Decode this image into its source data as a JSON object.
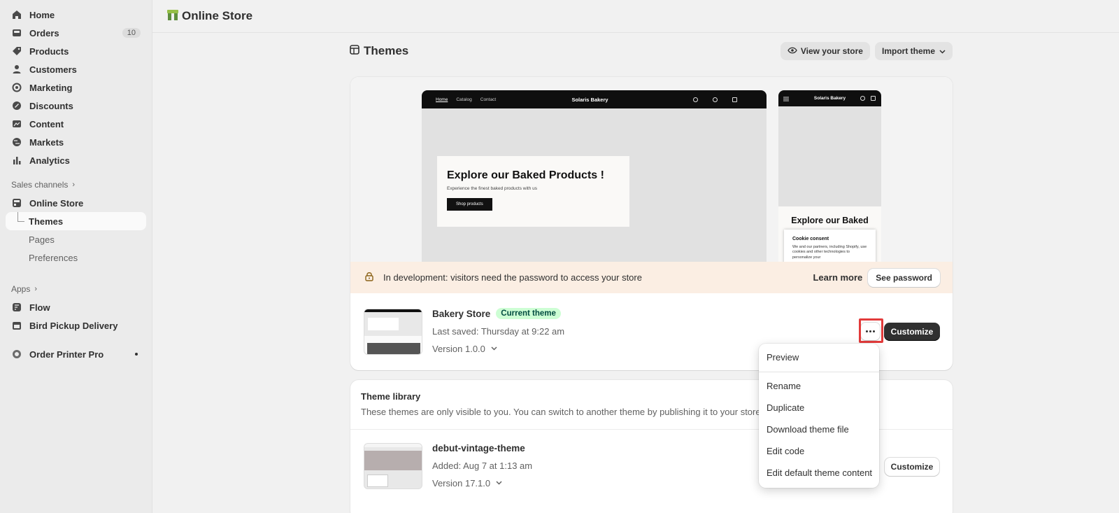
{
  "sidebar": {
    "nav": [
      {
        "label": "Home",
        "icon": "home-icon"
      },
      {
        "label": "Orders",
        "icon": "orders-icon",
        "badge": "10"
      },
      {
        "label": "Products",
        "icon": "tag-icon"
      },
      {
        "label": "Customers",
        "icon": "person-icon"
      },
      {
        "label": "Marketing",
        "icon": "target-icon"
      },
      {
        "label": "Discounts",
        "icon": "discount-icon"
      },
      {
        "label": "Content",
        "icon": "content-icon"
      },
      {
        "label": "Markets",
        "icon": "globe-icon"
      },
      {
        "label": "Analytics",
        "icon": "bar-chart-icon"
      }
    ],
    "sales_channels_label": "Sales channels",
    "online_store": "Online Store",
    "sub": [
      "Themes",
      "Pages",
      "Preferences"
    ],
    "apps_label": "Apps",
    "apps": [
      "Flow",
      "Bird Pickup Delivery"
    ],
    "order_printer": "Order Printer Pro"
  },
  "topbar": {
    "title": "Online Store"
  },
  "page": {
    "title": "Themes",
    "view_store": "View your store",
    "import_theme": "Import theme"
  },
  "preview": {
    "desktop": {
      "nav": [
        "Home",
        "Catalog",
        "Contact"
      ],
      "brand": "Solaris Bakery",
      "hero_title": "Explore our Baked Products !",
      "hero_sub": "Experience the finest baked products with us",
      "hero_button": "Shop products"
    },
    "mobile": {
      "brand": "Solaris Bakery",
      "hero_title": "Explore our Baked",
      "cookie_title": "Cookie consent",
      "cookie_text": "We and our partners, including Shopify, use cookies and other technologies to personalize your"
    }
  },
  "banner": {
    "message": "In development: visitors need the password to access your store",
    "learn_more": "Learn more",
    "see_password": "See password"
  },
  "current_theme": {
    "name": "Bakery Store",
    "tag": "Current theme",
    "saved": "Last saved: Thursday at 9:22 am",
    "version": "Version 1.0.0",
    "customize": "Customize"
  },
  "library": {
    "title": "Theme library",
    "desc": "These themes are only visible to you. You can switch to another theme by publishing it to your store.",
    "themes": [
      {
        "name": "debut-vintage-theme",
        "added": "Added: Aug 7 at 1:13 am",
        "version": "Version 17.1.0",
        "customize": "Customize"
      }
    ]
  },
  "menu": {
    "items": [
      "Preview",
      "Rename",
      "Duplicate",
      "Download theme file",
      "Edit code",
      "Edit default theme content"
    ]
  },
  "colors": {
    "accent": "#303030",
    "tag_bg": "#cdfed4",
    "banner_bg": "#fbeee3",
    "highlight": "#e23b3b"
  }
}
